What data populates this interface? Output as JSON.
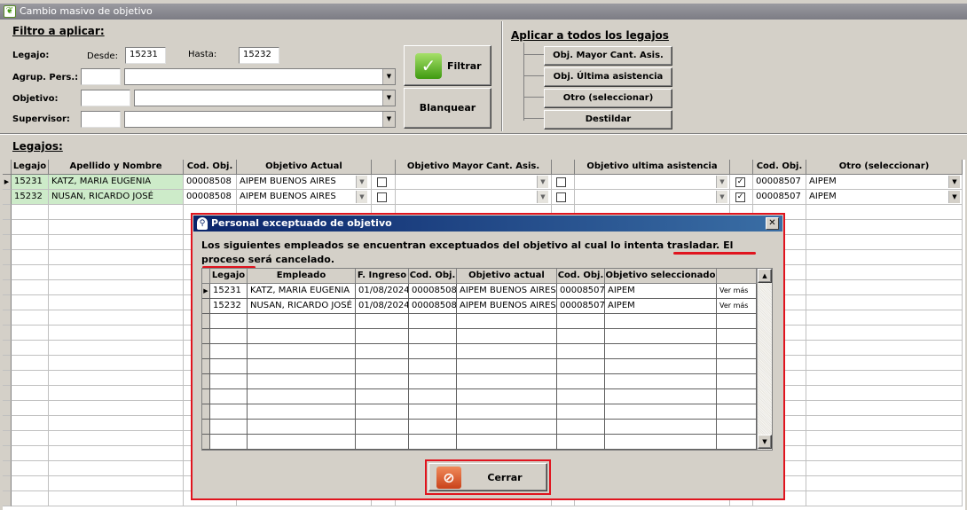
{
  "window": {
    "title": "Cambio masivo de objetivo"
  },
  "filter": {
    "title": "Filtro a aplicar:",
    "legajo_label": "Legajo:",
    "desde_label": "Desde:",
    "desde_value": "15231",
    "hasta_label": "Hasta:",
    "hasta_value": "15232",
    "agrup_label": "Agrup. Pers.:",
    "objetivo_label": "Objetivo:",
    "supervisor_label": "Supervisor:",
    "filtrar_label": "Filtrar",
    "blanquear_label": "Blanquear"
  },
  "apply_all": {
    "title": "Aplicar a todos los legajos",
    "buttons": [
      "Obj. Mayor Cant. Asis.",
      "Obj. Última asistencia",
      "Otro (seleccionar)",
      "Destildar"
    ]
  },
  "legajos": {
    "title": "Legajos:",
    "headers": [
      "Legajo",
      "Apellido y Nombre",
      "Cod. Obj.",
      "Objetivo Actual",
      "",
      "Objetivo Mayor Cant. Asis.",
      "",
      "Objetivo ultima asistencia",
      "",
      "Cod. Obj.",
      "Otro (seleccionar)"
    ],
    "rows": [
      {
        "legajo": "15231",
        "nombre": "KATZ, MARIA EUGENIA",
        "cod": "00008508",
        "objetivo": "AIPEM BUENOS AIRES",
        "otro_cod": "00008507",
        "otro": "AIPEM",
        "check_mark": "✓"
      },
      {
        "legajo": "15232",
        "nombre": "NUSAN, RICARDO JOSÉ",
        "cod": "00008508",
        "objetivo": "AIPEM BUENOS AIRES",
        "otro_cod": "00008507",
        "otro": "AIPEM",
        "check_mark": "✓"
      }
    ]
  },
  "dialog": {
    "title": "Personal exceptuado de objetivo",
    "close_glyph": "✕",
    "message_a": "Los siguientes empleados se encuentran exceptuados del objetivo al cual lo intenta trasladar. ",
    "message_b": "El proceso será cancelado",
    "message_c": ".",
    "headers": [
      "Legajo",
      "Empleado",
      "F. Ingreso",
      "Cod. Obj.",
      "Objetivo actual",
      "Cod. Obj.",
      "Objetivo seleccionado"
    ],
    "rows": [
      {
        "legajo": "15231",
        "empleado": "KATZ, MARIA EUGENIA",
        "ingreso": "01/08/2024",
        "cod": "00008508",
        "actual": "AIPEM BUENOS AIRES",
        "cod2": "00008507",
        "seleccionado": "AIPEM",
        "ver": "Ver más"
      },
      {
        "legajo": "15232",
        "empleado": "NUSAN, RICARDO JOSÉ",
        "ingreso": "01/08/2024",
        "cod": "00008508",
        "actual": "AIPEM BUENOS AIRES",
        "cod2": "00008507",
        "seleccionado": "AIPEM",
        "ver": "Ver más"
      }
    ],
    "cerrar_label": "Cerrar"
  },
  "colors": {
    "accent_red": "#e0141e",
    "row_green": "#cdebc9",
    "dialog_title": "#0a246a"
  }
}
